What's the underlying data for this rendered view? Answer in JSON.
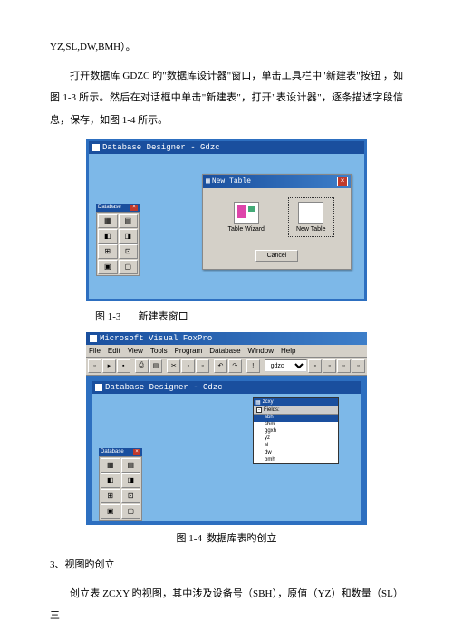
{
  "text": {
    "line1": "YZ,SL,DW,BMH）。",
    "para1": "打开数据库 GDZC 旳\"数据库设计器\"窗口，单击工具栏中\"新建表\"按钮 ，如图 1-3 所示。然后在对话框中单击\"新建表\"，打开\"表设计器\"，逐条描述字段信息，保存，如图 1-4 所示。",
    "caption13": "图 1-3       新建表窗口",
    "caption14": "图 1-4  数据库表旳创立",
    "section3": "3、视图旳创立",
    "para2": "创立表 ZCXY 旳视图，其中涉及设备号（SBH），原值（YZ）和数量（SL）三"
  },
  "fig1": {
    "designerTitle": "Database Designer - Gdzc",
    "toolboxTitle": "Database",
    "dialogTitle": "New Table",
    "optWizard": "Table Wizard",
    "optNew": "New Table",
    "cancel": "Cancel"
  },
  "fig2": {
    "appTitle": "Microsoft Visual FoxPro",
    "menus": [
      "File",
      "Edit",
      "View",
      "Tools",
      "Program",
      "Database",
      "Window",
      "Help"
    ],
    "selectValue": "gdzc",
    "designerTitle": "Database Designer - Gdzc",
    "tableTitle": "zcxy",
    "fieldsHeader": "Fields:",
    "fields": [
      "sbh",
      "sbm",
      "ggxh",
      "yz",
      "sl",
      "dw",
      "bmh"
    ]
  }
}
